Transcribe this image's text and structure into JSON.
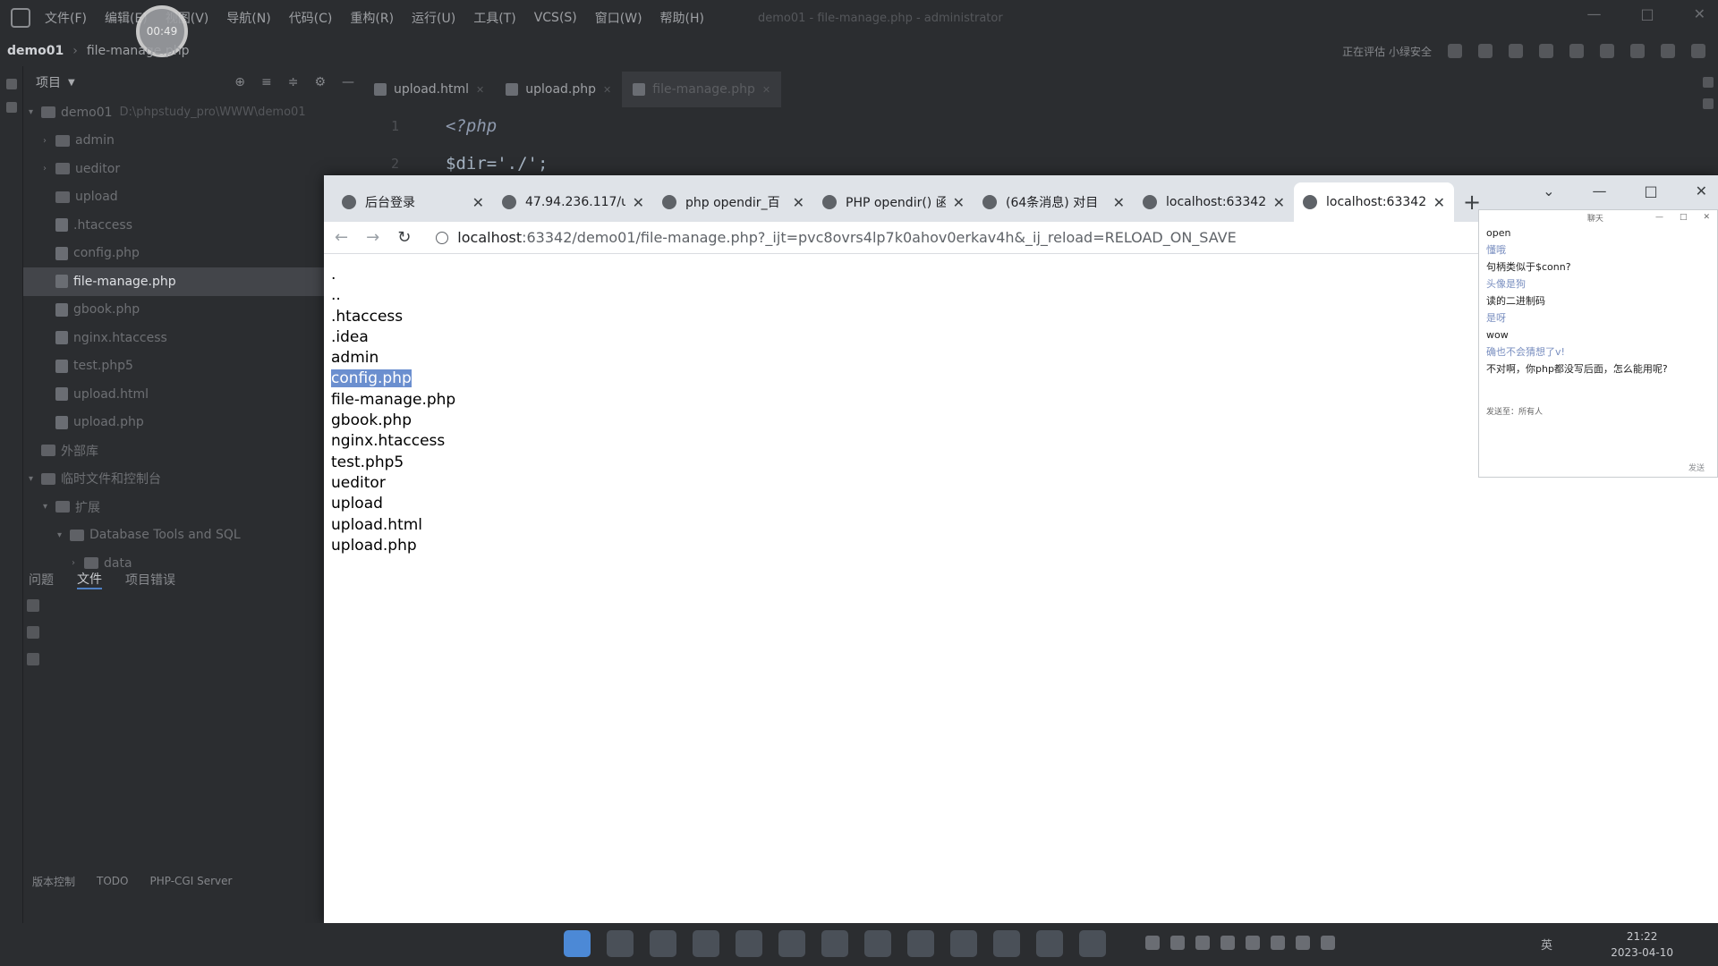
{
  "ide": {
    "menu": [
      "文件(F)",
      "编辑(E)",
      "视图(V)",
      "导航(N)",
      "代码(C)",
      "重构(R)",
      "运行(U)",
      "工具(T)",
      "VCS(S)",
      "窗口(W)",
      "帮助(H)"
    ],
    "window_title": "demo01 - file-manage.php - administrator",
    "record_timer": "00:49",
    "breadcrumb_project": "demo01",
    "breadcrumb_file": "file-manage.php",
    "toolbar_status": "正在评估 小绿安全",
    "project_panel_title": "项目",
    "tree": [
      {
        "label": "demo01",
        "extra": "D:\\phpstudy_pro\\WWW\\demo01",
        "kind": "folder",
        "indent": 0,
        "caret": "v"
      },
      {
        "label": "admin",
        "kind": "folder",
        "indent": 1,
        "caret": ">"
      },
      {
        "label": "ueditor",
        "kind": "folder",
        "indent": 1,
        "caret": ">"
      },
      {
        "label": "upload",
        "kind": "folder",
        "indent": 1,
        "caret": ""
      },
      {
        "label": ".htaccess",
        "kind": "file",
        "indent": 1,
        "caret": ""
      },
      {
        "label": "config.php",
        "kind": "file",
        "indent": 1,
        "caret": ""
      },
      {
        "label": "file-manage.php",
        "kind": "file",
        "indent": 1,
        "caret": "",
        "selected": true
      },
      {
        "label": "gbook.php",
        "kind": "file",
        "indent": 1,
        "caret": ""
      },
      {
        "label": "nginx.htaccess",
        "kind": "file",
        "indent": 1,
        "caret": ""
      },
      {
        "label": "test.php5",
        "kind": "file",
        "indent": 1,
        "caret": ""
      },
      {
        "label": "upload.html",
        "kind": "file",
        "indent": 1,
        "caret": ""
      },
      {
        "label": "upload.php",
        "kind": "file",
        "indent": 1,
        "caret": ""
      },
      {
        "label": "外部库",
        "kind": "folder",
        "indent": 0,
        "caret": ""
      },
      {
        "label": "临时文件和控制台",
        "kind": "folder",
        "indent": 0,
        "caret": "v"
      },
      {
        "label": "扩展",
        "kind": "folder",
        "indent": 1,
        "caret": "v"
      },
      {
        "label": "Database Tools and SQL",
        "kind": "folder",
        "indent": 2,
        "caret": "v"
      },
      {
        "label": "data",
        "kind": "folder",
        "indent": 3,
        "caret": ">"
      }
    ],
    "bottom_tabs": [
      "问题",
      "文件",
      "项目错误"
    ],
    "status_items": [
      "版本控制",
      "TODO",
      "PHP-CGI Server"
    ],
    "editor_tabs": [
      {
        "label": "upload.html",
        "active": false
      },
      {
        "label": "upload.php",
        "active": false
      },
      {
        "label": "file-manage.php",
        "active": true
      }
    ],
    "code": [
      {
        "num": "1",
        "text": "<?php",
        "style": "kw"
      },
      {
        "num": "2",
        "text": "$dir='./';",
        "style": "code"
      }
    ]
  },
  "browser": {
    "tabs": [
      {
        "label": "后台登录",
        "active": false
      },
      {
        "label": "47.94.236.117/u",
        "active": false
      },
      {
        "label": "php opendir_百",
        "active": false
      },
      {
        "label": "PHP opendir() 函",
        "active": false
      },
      {
        "label": "(64条消息) 对目",
        "active": false
      },
      {
        "label": "localhost:63342",
        "active": false
      },
      {
        "label": "localhost:63342",
        "active": true
      }
    ],
    "url_host": "localhost",
    "url_rest": ":63342/demo01/file-manage.php?_ijt=pvc8ovrs4lp7k0ahov0erkav4h&_ij_reload=RELOAD_ON_SAVE",
    "entries": [
      ".",
      "..",
      ".htaccess",
      ".idea",
      "admin",
      "config.php",
      "file-manage.php",
      "gbook.php",
      "nginx.htaccess",
      "test.php5",
      "ueditor",
      "upload",
      "upload.html",
      "upload.php"
    ],
    "highlighted_entry": "config.php"
  },
  "chat": {
    "title": "聊天",
    "messages": [
      {
        "text": "open",
        "dim": false
      },
      {
        "text": "懂哦",
        "dim": true
      },
      {
        "text": "句柄类似于$conn?",
        "dim": false
      },
      {
        "text": "头像是狗",
        "dim": true
      },
      {
        "text": "读的二进制码",
        "dim": false
      },
      {
        "text": "是呀",
        "dim": true
      },
      {
        "text": "wow",
        "dim": false
      },
      {
        "text": "确也不会猜想了v!",
        "dim": true
      },
      {
        "text": "不对啊，你php都没写后面，怎么能用呢?",
        "dim": false
      }
    ],
    "sender_label": "发送至：所有人",
    "send_button": "发送"
  },
  "taskbar": {
    "lang": "英",
    "time": "21:22",
    "date": "2023-04-10"
  }
}
